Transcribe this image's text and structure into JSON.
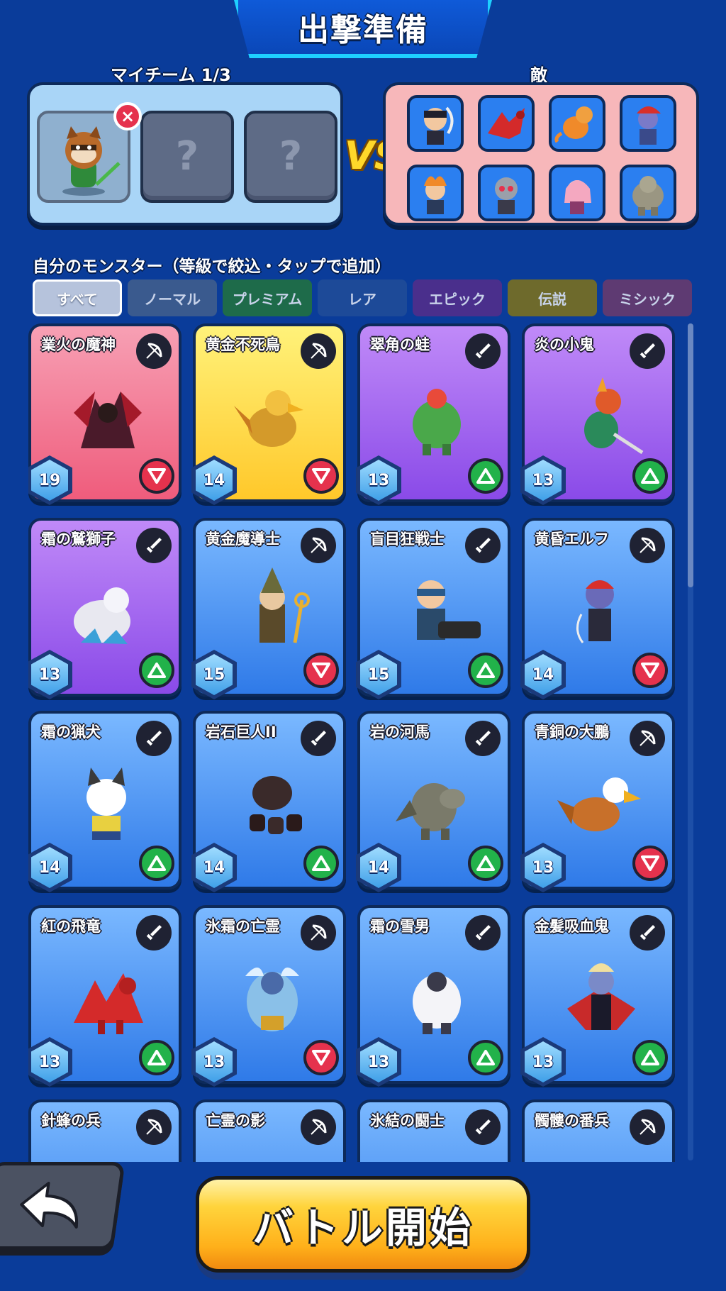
{
  "header": {
    "title": "出撃準備"
  },
  "team": {
    "label": "マイチーム 1/3",
    "slots": [
      {
        "state": "filled",
        "monster": "raccoon-warrior"
      },
      {
        "state": "empty",
        "placeholder": "?"
      },
      {
        "state": "empty",
        "placeholder": "?"
      }
    ],
    "remove_icon": "×"
  },
  "vs_label": "VS",
  "enemy": {
    "label": "敵",
    "count": 8
  },
  "monsters_section": {
    "title": "自分のモンスター（等級で絞込・タップで追加）",
    "filters": [
      {
        "label": "すべて",
        "color": "#b6c3dc",
        "active": true
      },
      {
        "label": "ノーマル",
        "color": "#3a5a8e"
      },
      {
        "label": "プレミアム",
        "color": "#1e6b4a"
      },
      {
        "label": "レア",
        "color": "#1d4a98"
      },
      {
        "label": "エピック",
        "color": "#4a2f8c"
      },
      {
        "label": "伝説",
        "color": "#6e6a2c"
      },
      {
        "label": "ミシック",
        "color": "#5e3a72"
      }
    ]
  },
  "cards": [
    {
      "name": "業火の魔神",
      "level": "19",
      "type_icon": "bow-icon",
      "cmp": "down",
      "bg": "pink"
    },
    {
      "name": "黄金不死鳥",
      "level": "14",
      "type_icon": "bow-icon",
      "cmp": "down",
      "bg": "yellow"
    },
    {
      "name": "翠角の蛙",
      "level": "13",
      "type_icon": "sword-icon",
      "cmp": "up",
      "bg": "purple"
    },
    {
      "name": "炎の小鬼",
      "level": "13",
      "type_icon": "sword-icon",
      "cmp": "up",
      "bg": "purple"
    },
    {
      "name": "霜の鷲獅子",
      "level": "13",
      "type_icon": "sword-icon",
      "cmp": "up",
      "bg": "purple"
    },
    {
      "name": "黄金魔導士",
      "level": "15",
      "type_icon": "bow-icon",
      "cmp": "down",
      "bg": "blue"
    },
    {
      "name": "盲目狂戦士",
      "level": "15",
      "type_icon": "sword-icon",
      "cmp": "up",
      "bg": "blue"
    },
    {
      "name": "黄昏エルフ",
      "level": "14",
      "type_icon": "bow-icon",
      "cmp": "down",
      "bg": "blue"
    },
    {
      "name": "霜の猟犬",
      "level": "14",
      "type_icon": "sword-icon",
      "cmp": "up",
      "bg": "blue"
    },
    {
      "name": "岩石巨人II",
      "level": "14",
      "type_icon": "sword-icon",
      "cmp": "up",
      "bg": "blue"
    },
    {
      "name": "岩の河馬",
      "level": "14",
      "type_icon": "sword-icon",
      "cmp": "up",
      "bg": "blue"
    },
    {
      "name": "青銅の大鵬",
      "level": "13",
      "type_icon": "bow-icon",
      "cmp": "down",
      "bg": "blue"
    },
    {
      "name": "紅の飛竜",
      "level": "13",
      "type_icon": "sword-icon",
      "cmp": "up",
      "bg": "blue"
    },
    {
      "name": "氷霜の亡霊",
      "level": "13",
      "type_icon": "bow-icon",
      "cmp": "down",
      "bg": "blue"
    },
    {
      "name": "霜の雪男",
      "level": "13",
      "type_icon": "sword-icon",
      "cmp": "up",
      "bg": "blue"
    },
    {
      "name": "金髪吸血鬼",
      "level": "13",
      "type_icon": "sword-icon",
      "cmp": "up",
      "bg": "blue"
    },
    {
      "name": "針蜂の兵",
      "level": "",
      "type_icon": "bow-icon",
      "cmp": "",
      "bg": "blue"
    },
    {
      "name": "亡霊の影",
      "level": "",
      "type_icon": "bow-icon",
      "cmp": "",
      "bg": "blue"
    },
    {
      "name": "氷結の闘士",
      "level": "",
      "type_icon": "sword-icon",
      "cmp": "",
      "bg": "blue"
    },
    {
      "name": "髑髏の番兵",
      "level": "",
      "type_icon": "bow-icon",
      "cmp": "",
      "bg": "blue"
    }
  ],
  "footer": {
    "back_icon": "back-arrow-icon",
    "start_label": "バトル開始"
  },
  "colors": {
    "background": "#0a3c9a",
    "card_pink": "#f06a8a",
    "card_yellow": "#ffd640",
    "card_purple": "#9a5cf0",
    "card_blue": "#3d8cf0",
    "up": "#22b24a",
    "down": "#e5324d"
  }
}
